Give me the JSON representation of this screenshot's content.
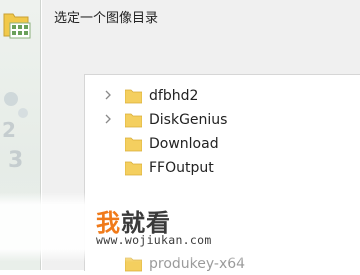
{
  "dialog": {
    "title": "选定一个图像目录"
  },
  "folder_tree": {
    "items": [
      {
        "label": "dfbhd2",
        "expandable": true
      },
      {
        "label": "DiskGenius",
        "expandable": true
      },
      {
        "label": "Download",
        "expandable": false
      },
      {
        "label": "FFOutput",
        "expandable": false
      },
      {
        "label": "produkey-x64",
        "expandable": false
      }
    ]
  },
  "left_panel": {
    "icon": "folder-grid-icon"
  },
  "watermark": {
    "brand_first": "我",
    "brand_rest": "就看",
    "url": "www.wojiukan.com"
  },
  "colors": {
    "folder": "#f4cf5f",
    "chevron": "#8a8a8a",
    "brand_orange": "#f07a1a",
    "dialog_bg": "#f0f0f0"
  }
}
